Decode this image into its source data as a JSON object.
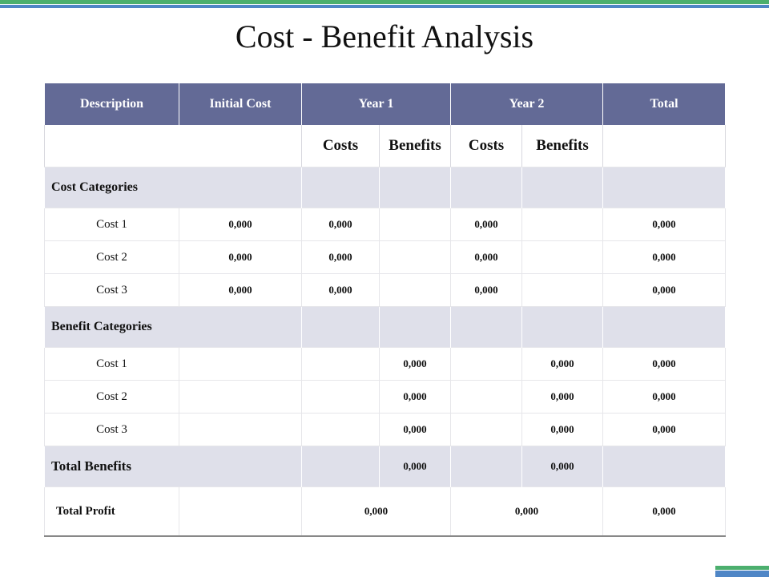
{
  "title": "Cost - Benefit Analysis",
  "header": {
    "description": "Description",
    "initial_cost": "Initial Cost",
    "year1": "Year 1",
    "year2": "Year 2",
    "total": "Total"
  },
  "subheader": {
    "y1_costs": "Costs",
    "y1_benefits": "Benefits",
    "y2_costs": "Costs",
    "y2_benefits": "Benefits"
  },
  "cost_categories": {
    "label": "Cost Categories",
    "rows": [
      {
        "label": "Cost 1",
        "initial": "0,000",
        "y1_costs": "0,000",
        "y1_benefits": "",
        "y2_costs": "0,000",
        "y2_benefits": "",
        "total": "0,000"
      },
      {
        "label": "Cost 2",
        "initial": "0,000",
        "y1_costs": "0,000",
        "y1_benefits": "",
        "y2_costs": "0,000",
        "y2_benefits": "",
        "total": "0,000"
      },
      {
        "label": "Cost 3",
        "initial": "0,000",
        "y1_costs": "0,000",
        "y1_benefits": "",
        "y2_costs": "0,000",
        "y2_benefits": "",
        "total": "0,000"
      }
    ]
  },
  "benefit_categories": {
    "label": "Benefit Categories",
    "rows": [
      {
        "label": "Cost 1",
        "initial": "",
        "y1_costs": "",
        "y1_benefits": "0,000",
        "y2_costs": "",
        "y2_benefits": "0,000",
        "total": "0,000"
      },
      {
        "label": "Cost 2",
        "initial": "",
        "y1_costs": "",
        "y1_benefits": "0,000",
        "y2_costs": "",
        "y2_benefits": "0,000",
        "total": "0,000"
      },
      {
        "label": "Cost 3",
        "initial": "",
        "y1_costs": "",
        "y1_benefits": "0,000",
        "y2_costs": "",
        "y2_benefits": "0,000",
        "total": "0,000"
      }
    ]
  },
  "total_benefits": {
    "label": "Total Benefits",
    "y1_benefits": "0,000",
    "y2_benefits": "0,000"
  },
  "total_profit": {
    "label": "Total Profit",
    "year1": "0,000",
    "year2": "0,000",
    "total": "0,000"
  },
  "colors": {
    "header_bg": "#636a96",
    "category_bg": "#dfe0ea",
    "accent_green": "#4caf6e",
    "accent_blue": "#4f86c6"
  }
}
